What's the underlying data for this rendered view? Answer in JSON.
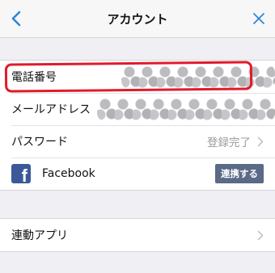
{
  "header": {
    "title": "アカウント",
    "back_icon": "chevron-left-icon",
    "close_icon": "close-icon",
    "accent_color": "#2f86d6"
  },
  "account_rows": [
    {
      "label": "電話番号",
      "value_redacted": true
    },
    {
      "label": "メールアドレス",
      "value_redacted": true
    },
    {
      "label": "パスワード",
      "value": "登録完了"
    },
    {
      "label": "Facebook",
      "action": "連携する"
    }
  ],
  "apps_row": {
    "label": "連動アプリ"
  },
  "annotation_color": "#e11a2b"
}
